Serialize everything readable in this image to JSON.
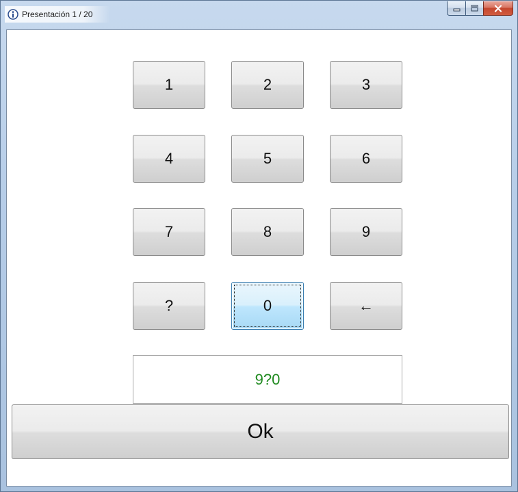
{
  "window": {
    "title": "Presentación 1 / 20",
    "icons": {
      "app": "info-icon",
      "minimize": "minimize-icon",
      "maximize": "maximize-icon",
      "close": "close-icon"
    }
  },
  "keypad": {
    "keys": [
      "1",
      "2",
      "3",
      "4",
      "5",
      "6",
      "7",
      "8",
      "9",
      "?",
      "0",
      "←"
    ],
    "focused_key": "0"
  },
  "display": {
    "value": "9?0",
    "color": "#1f8a1f"
  },
  "ok_button": {
    "label": "Ok"
  }
}
